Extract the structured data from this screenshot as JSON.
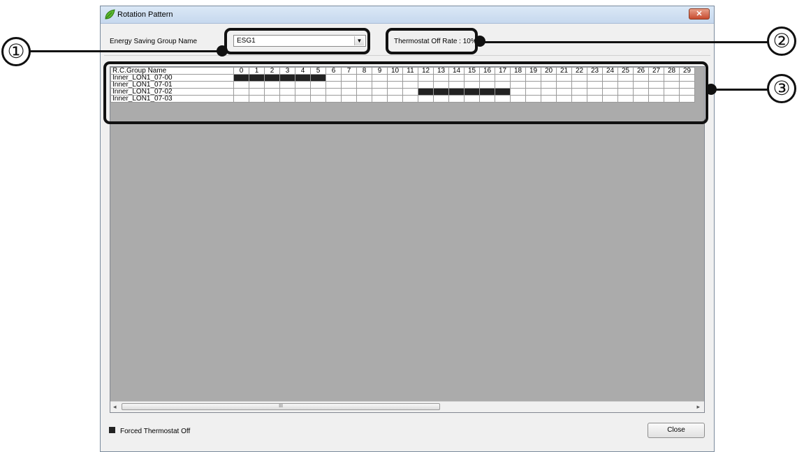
{
  "window": {
    "title": "Rotation Pattern",
    "close_glyph": "✕"
  },
  "group": {
    "label": "Energy Saving Group Name",
    "selected": "ESG1"
  },
  "rate": {
    "text": "Thermostat Off Rate : 10%"
  },
  "grid": {
    "header_name": "R.C.Group Name",
    "columns": [
      "0",
      "1",
      "2",
      "3",
      "4",
      "5",
      "6",
      "7",
      "8",
      "9",
      "10",
      "11",
      "12",
      "13",
      "14",
      "15",
      "16",
      "17",
      "18",
      "19",
      "20",
      "21",
      "22",
      "23",
      "24",
      "25",
      "26",
      "27",
      "28",
      "29"
    ],
    "rows": [
      {
        "name": "Inner_LON1_07-00",
        "on": [
          0,
          1,
          2,
          3,
          4,
          5
        ]
      },
      {
        "name": "Inner_LON1_07-01",
        "on": []
      },
      {
        "name": "Inner_LON1_07-02",
        "on": [
          12,
          13,
          14,
          15,
          16,
          17
        ]
      },
      {
        "name": "Inner_LON1_07-03",
        "on": []
      }
    ]
  },
  "scrollbar": {
    "left_arrow": "◂",
    "right_arrow": "▸",
    "grip": "III"
  },
  "legend": {
    "label": "Forced Thermostat Off"
  },
  "buttons": {
    "close": "Close"
  },
  "annotations": [
    "①",
    "②",
    "③"
  ],
  "colors": {
    "forced_off": "#222222",
    "grid_bg": "#ababab"
  }
}
